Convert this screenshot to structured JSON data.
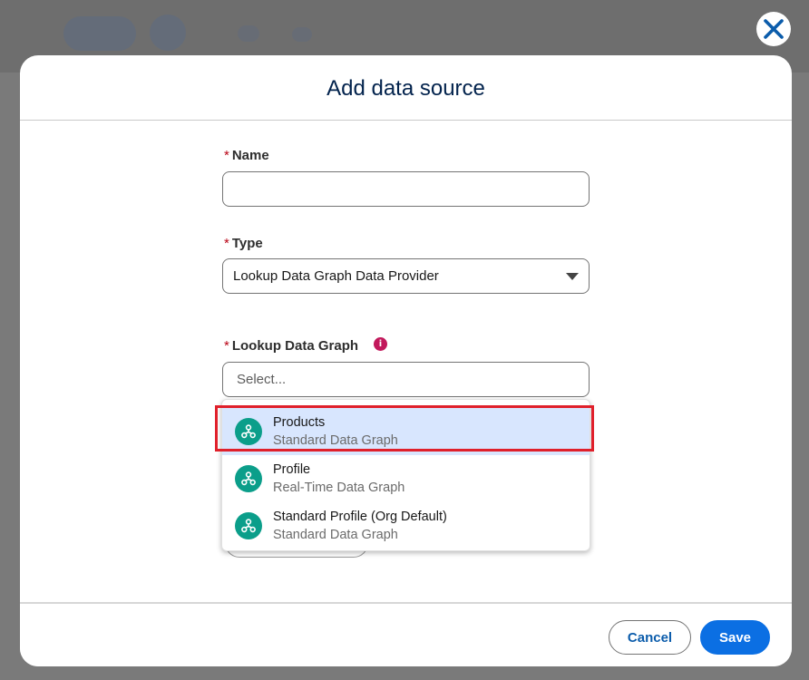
{
  "modal": {
    "title": "Add data source"
  },
  "form": {
    "name": {
      "required_marker": "*",
      "label": "Name",
      "value": ""
    },
    "type": {
      "required_marker": "*",
      "label": "Type",
      "selected": "Lookup Data Graph Data Provider"
    },
    "lookup_data_graph": {
      "required_marker": "*",
      "label": "Lookup Data Graph",
      "info_icon": "i",
      "placeholder": "Select...",
      "options": [
        {
          "title": "Products",
          "subtitle": "Standard Data Graph",
          "selected": true
        },
        {
          "title": "Profile",
          "subtitle": "Real-Time Data Graph",
          "selected": false
        },
        {
          "title": "Standard Profile (Org Default)",
          "subtitle": "Standard Data Graph",
          "selected": false
        }
      ]
    }
  },
  "footer": {
    "cancel_label": "Cancel",
    "save_label": "Save"
  },
  "colors": {
    "brand_blue": "#0b6fe3",
    "title_navy": "#03234d",
    "required_red": "#ba0517",
    "option_icon_teal": "#0b9e8a",
    "selected_option_bg": "#d8e6fe",
    "highlight_border": "#e0202b",
    "info_icon_bg": "#c2185b"
  },
  "icons": {
    "close": "close-icon",
    "dropdown": "chevron-down-icon",
    "info": "info-icon",
    "option": "data-graph-icon"
  }
}
